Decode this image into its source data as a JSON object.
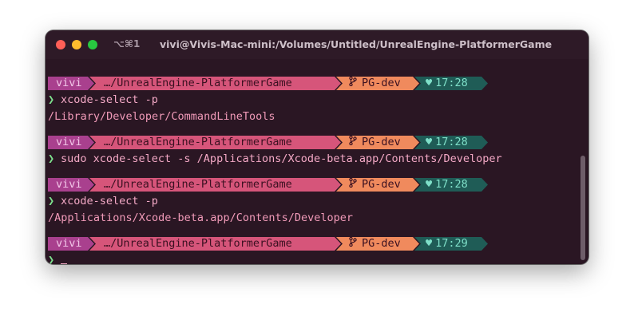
{
  "window": {
    "shortcut": "⌥⌘1",
    "title": "vivi@Vivis-Mac-mini:/Volumes/Untitled/UnrealEngine-PlatformerGame"
  },
  "prompts": [
    {
      "user": "vivi",
      "path": "…/UnrealEngine-PlatformerGame",
      "branch": "PG-dev",
      "time": "17:28"
    },
    {
      "user": "vivi",
      "path": "…/UnrealEngine-PlatformerGame",
      "branch": "PG-dev",
      "time": "17:28"
    },
    {
      "user": "vivi",
      "path": "…/UnrealEngine-PlatformerGame",
      "branch": "PG-dev",
      "time": "17:28"
    },
    {
      "user": "vivi",
      "path": "…/UnrealEngine-PlatformerGame",
      "branch": "PG-dev",
      "time": "17:29"
    }
  ],
  "commands": [
    "xcode-select -p",
    "sudo xcode-select -s /Applications/Xcode-beta.app/Contents/Developer",
    "xcode-select -p",
    ""
  ],
  "outputs": [
    "/Library/Developer/CommandLineTools",
    "",
    "/Applications/Xcode-beta.app/Contents/Developer"
  ],
  "prompt_symbol": "❯",
  "icons": {
    "branch": "git-branch-icon",
    "time": "heart-icon"
  },
  "colors": {
    "background": "#2a1623",
    "user": "#a9408e",
    "path": "#d6557a",
    "branch": "#f08a5d",
    "time": "#1f5c56",
    "chevron": "#7fe38f"
  }
}
